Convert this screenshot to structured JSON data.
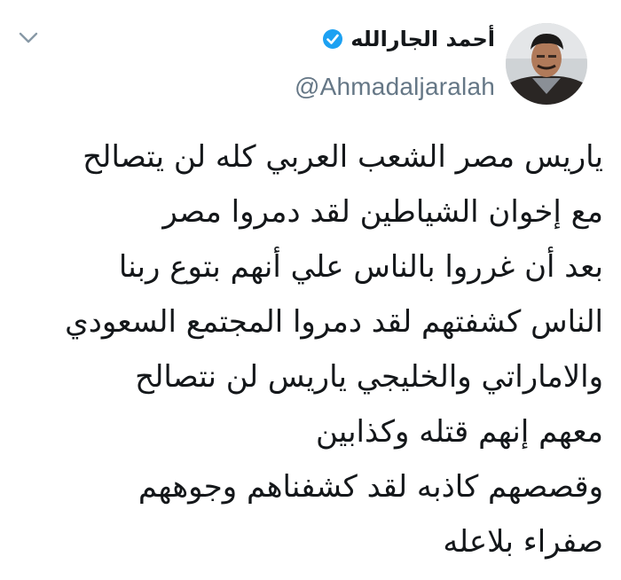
{
  "author": {
    "display_name": "أحمد الجارالله",
    "handle": "@Ahmadaljaralah",
    "verified": true
  },
  "icons": {
    "menu": "chevron-down-icon",
    "verified": "verified-badge-icon",
    "avatar": "profile-photo"
  },
  "colors": {
    "verified_blue": "#1da1f2",
    "handle_gray": "#657786",
    "text": "#14171a",
    "chevron": "#8899a6"
  },
  "tweet": {
    "lines": [
      "ياريس مصر الشعب العربي كله لن يتصالح",
      "مع إخوان الشياطين لقد دمروا مصر",
      "بعد أن غرروا بالناس علي أنهم بتوع ربنا",
      "الناس كشفتهم لقد دمروا المجتمع السعودي",
      "والاماراتي والخليجي ياريس لن نتصالح",
      "معهم إنهم قتله وكذابين",
      "وقصصهم كاذبه لقد كشفناهم وجوههم",
      "صفراء بلاعله"
    ]
  }
}
